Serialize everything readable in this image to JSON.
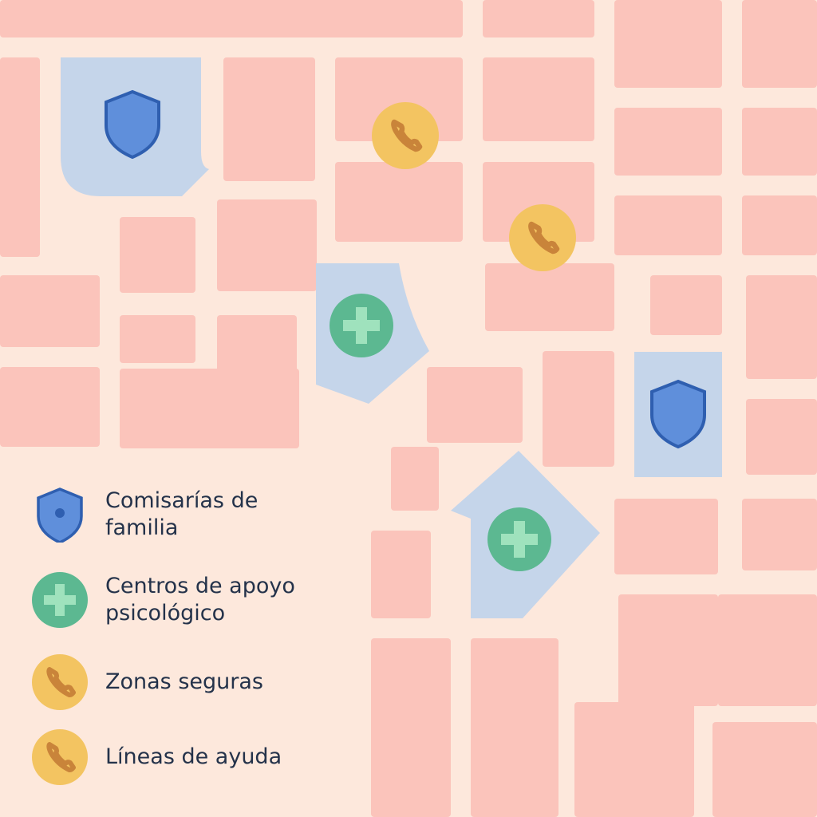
{
  "colors": {
    "background": "#fde8dc",
    "block": "#fbc4bb",
    "street": "#fde8dc",
    "highlight_area": "#c5d5ea",
    "shield_fill": "#5f8fdb",
    "shield_stroke": "#2f5fb0",
    "cross_fill": "#5cb891",
    "cross_symbol": "#9fe2bd",
    "phone_fill": "#f3c461",
    "phone_symbol": "#c9843a",
    "label_text": "#24324a"
  },
  "map": {
    "markers": [
      {
        "type": "comisaria",
        "icon": "shield-icon"
      },
      {
        "type": "comisaria",
        "icon": "shield-icon"
      },
      {
        "type": "centro_apoyo",
        "icon": "cross-icon"
      },
      {
        "type": "centro_apoyo",
        "icon": "cross-icon"
      },
      {
        "type": "linea_ayuda",
        "icon": "phone-icon"
      },
      {
        "type": "linea_ayuda",
        "icon": "phone-icon"
      }
    ]
  },
  "legend": {
    "items": [
      {
        "icon": "shield-icon",
        "label": "Comisarías de familia"
      },
      {
        "icon": "cross-icon",
        "label": "Centros de apoyo psicológico"
      },
      {
        "icon": "phone-icon",
        "label": "Zonas seguras"
      },
      {
        "icon": "phone-icon",
        "label": "Líneas de ayuda"
      }
    ]
  }
}
